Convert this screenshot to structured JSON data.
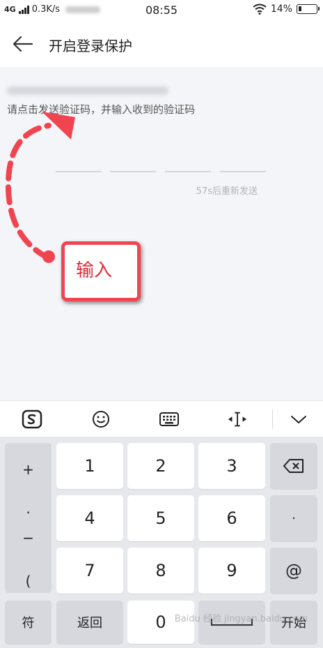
{
  "status_bar": {
    "network": "4G",
    "speed": "0.3K/s",
    "time": "08:55",
    "battery": "14%",
    "battery_level": 0.14
  },
  "header": {
    "title": "开启登录保护"
  },
  "content": {
    "hint": "请点击发送验证码，并输入收到的验证码",
    "resend": "57s后重新发送"
  },
  "annotation": {
    "label": "输入",
    "color": "#f04450"
  },
  "toolbar": {
    "icons": [
      "sogou-logo-icon",
      "emoji-icon",
      "keyboard-icon",
      "cursor-move-icon",
      "collapse-icon"
    ]
  },
  "keypad": {
    "symbols": [
      "+",
      ".",
      "−",
      "("
    ],
    "digits": [
      "1",
      "2",
      "3",
      "4",
      "5",
      "6",
      "7",
      "8",
      "9",
      "0"
    ],
    "dot": "·",
    "at": "@",
    "fu": "符",
    "back": "返回",
    "start": "开始"
  },
  "watermark": "Baidu 经验 jingyan.baidu.com"
}
